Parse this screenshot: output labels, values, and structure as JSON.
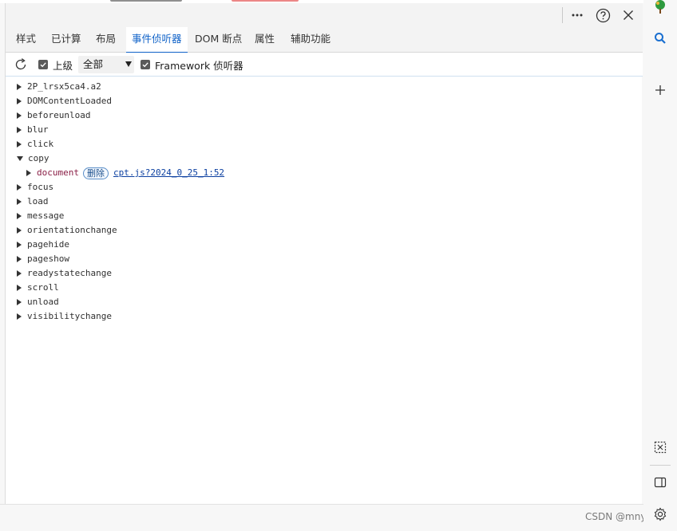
{
  "topbar": {
    "more_icon": "more-horizontal-icon",
    "help_icon": "help-circle-icon",
    "close_icon": "close-icon"
  },
  "tabs": [
    {
      "label": "样式",
      "active": false
    },
    {
      "label": "已计算",
      "active": false
    },
    {
      "label": "布局",
      "active": false
    },
    {
      "label": "事件侦听器",
      "active": true
    },
    {
      "label": "DOM 断点",
      "active": false
    },
    {
      "label": "属性",
      "active": false
    },
    {
      "label": "辅助功能",
      "active": false
    }
  ],
  "toolbar": {
    "refresh_icon": "refresh-icon",
    "ancestors_label": "上级",
    "ancestors_checked": true,
    "filter_selected": "全部",
    "framework_label": "Framework 侦听器",
    "framework_checked": true
  },
  "events": [
    {
      "name": "2P_lrsx5ca4.a2",
      "expanded": false
    },
    {
      "name": "DOMContentLoaded",
      "expanded": false
    },
    {
      "name": "beforeunload",
      "expanded": false
    },
    {
      "name": "blur",
      "expanded": false
    },
    {
      "name": "click",
      "expanded": false
    },
    {
      "name": "copy",
      "expanded": true
    },
    {
      "name": "focus",
      "expanded": false
    },
    {
      "name": "load",
      "expanded": false
    },
    {
      "name": "message",
      "expanded": false
    },
    {
      "name": "orientationchange",
      "expanded": false
    },
    {
      "name": "pagehide",
      "expanded": false
    },
    {
      "name": "pageshow",
      "expanded": false
    },
    {
      "name": "readystatechange",
      "expanded": false
    },
    {
      "name": "scroll",
      "expanded": false
    },
    {
      "name": "unload",
      "expanded": false
    },
    {
      "name": "visibilitychange",
      "expanded": false
    }
  ],
  "copy_listener": {
    "node": "document",
    "remove_label": "删除",
    "source_link": "cpt.js?2024_0_25_1:52"
  },
  "watermark": "CSDN @mnyou",
  "sidebar": {
    "items": [
      "tree-icon",
      "search-icon",
      "add-icon",
      "screenshot-icon",
      "sidebar-layout-icon",
      "settings-icon"
    ]
  },
  "colors": {
    "accent": "#0f62c8",
    "node": "#8a1f46",
    "link": "#0b3fa0"
  }
}
